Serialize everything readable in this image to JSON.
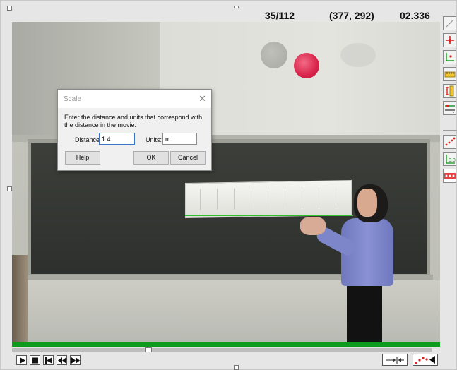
{
  "status": {
    "frame_counter": "35/112",
    "coordinates": "(377, 292)",
    "time": "02.336"
  },
  "dialog": {
    "title": "Scale",
    "close_glyph": "✕",
    "message": "Enter the distance and units that correspond with the distance in the movie.",
    "distance_label": "Distance:",
    "distance_value": "1.4",
    "units_label": "Units:",
    "units_value": "m",
    "help_label": "Help",
    "ok_label": "OK",
    "cancel_label": "Cancel"
  },
  "toolbar": {
    "icons": [
      "pen-icon",
      "crosshair-icon",
      "axes-icon",
      "ruler-icon",
      "vertical-ruler-icon",
      "track-settings-icon",
      "points-icon",
      "origin-icon",
      "distance-icon"
    ]
  },
  "colors": {
    "accent_red": "#d9234a",
    "track_green": "#0f9a1b",
    "selection_blue": "#3c74c8"
  }
}
